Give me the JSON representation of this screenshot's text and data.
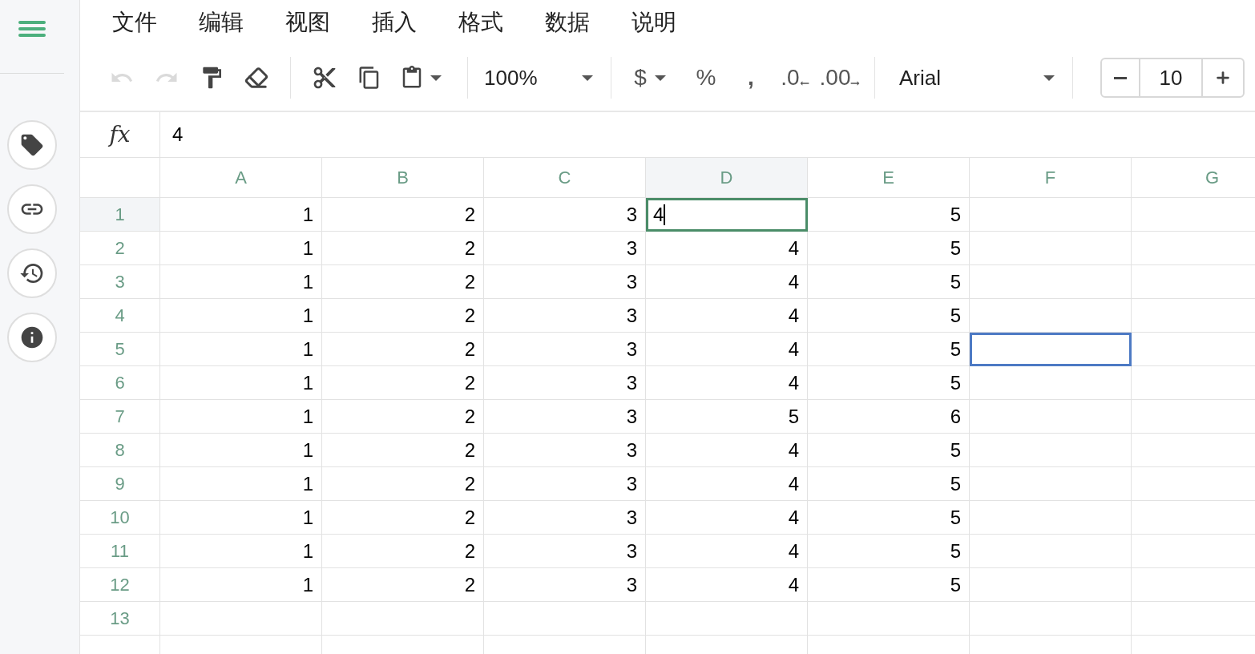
{
  "menu": [
    {
      "label": "文件"
    },
    {
      "label": "编辑"
    },
    {
      "label": "视图"
    },
    {
      "label": "插入"
    },
    {
      "label": "格式"
    },
    {
      "label": "数据"
    },
    {
      "label": "说明"
    }
  ],
  "toolbar": {
    "history": [
      {
        "kind": "undo",
        "disabled": true
      },
      {
        "kind": "redo",
        "disabled": true
      }
    ],
    "zoom": {
      "value": "100%"
    },
    "number_formats": [
      {
        "kind": "currency",
        "label": "$"
      },
      {
        "kind": "percent",
        "label": "%"
      },
      {
        "kind": "comma",
        "label": ","
      },
      {
        "kind": "decrease-decimals",
        "label": ".0"
      },
      {
        "kind": "increase-decimals",
        "label": ".00"
      }
    ],
    "font": {
      "value": "Arial"
    },
    "font_size": {
      "value": "10"
    }
  },
  "formula_bar": {
    "label": "fx",
    "value": "4"
  },
  "sheet": {
    "columns": [
      {
        "label": "A",
        "selected": false
      },
      {
        "label": "B",
        "selected": false
      },
      {
        "label": "C",
        "selected": false
      },
      {
        "label": "D",
        "selected": true
      },
      {
        "label": "E",
        "selected": false
      },
      {
        "label": "F",
        "selected": false
      },
      {
        "label": "G",
        "selected": false
      }
    ],
    "rows": [
      {
        "label": "1",
        "selected": true,
        "cells": [
          {
            "kind": "plain",
            "value": "1"
          },
          {
            "kind": "plain",
            "value": "2"
          },
          {
            "kind": "plain",
            "value": "3"
          },
          {
            "kind": "editing",
            "value": "4"
          },
          {
            "kind": "plain",
            "value": "5"
          },
          {
            "kind": "plain"
          },
          {
            "kind": "plain"
          }
        ]
      },
      {
        "label": "2",
        "selected": false,
        "cells": [
          {
            "kind": "plain",
            "value": "1"
          },
          {
            "kind": "plain",
            "value": "2"
          },
          {
            "kind": "plain",
            "value": "3"
          },
          {
            "kind": "plain",
            "value": "4"
          },
          {
            "kind": "plain",
            "value": "5"
          },
          {
            "kind": "plain"
          },
          {
            "kind": "plain"
          }
        ]
      },
      {
        "label": "3",
        "selected": false,
        "cells": [
          {
            "kind": "plain",
            "value": "1"
          },
          {
            "kind": "plain",
            "value": "2"
          },
          {
            "kind": "plain",
            "value": "3"
          },
          {
            "kind": "plain",
            "value": "4"
          },
          {
            "kind": "plain",
            "value": "5"
          },
          {
            "kind": "plain"
          },
          {
            "kind": "plain"
          }
        ]
      },
      {
        "label": "4",
        "selected": false,
        "cells": [
          {
            "kind": "plain",
            "value": "1"
          },
          {
            "kind": "plain",
            "value": "2"
          },
          {
            "kind": "plain",
            "value": "3"
          },
          {
            "kind": "plain",
            "value": "4"
          },
          {
            "kind": "plain",
            "value": "5"
          },
          {
            "kind": "plain"
          },
          {
            "kind": "plain"
          }
        ]
      },
      {
        "label": "5",
        "selected": false,
        "cells": [
          {
            "kind": "plain",
            "value": "1"
          },
          {
            "kind": "plain",
            "value": "2"
          },
          {
            "kind": "plain",
            "value": "3"
          },
          {
            "kind": "plain",
            "value": "4"
          },
          {
            "kind": "plain",
            "value": "5"
          },
          {
            "kind": "selected"
          },
          {
            "kind": "plain"
          }
        ]
      },
      {
        "label": "6",
        "selected": false,
        "cells": [
          {
            "kind": "plain",
            "value": "1"
          },
          {
            "kind": "plain",
            "value": "2"
          },
          {
            "kind": "plain",
            "value": "3"
          },
          {
            "kind": "plain",
            "value": "4"
          },
          {
            "kind": "plain",
            "value": "5"
          },
          {
            "kind": "plain"
          },
          {
            "kind": "plain"
          }
        ]
      },
      {
        "label": "7",
        "selected": false,
        "cells": [
          {
            "kind": "plain",
            "value": "1"
          },
          {
            "kind": "plain",
            "value": "2"
          },
          {
            "kind": "plain",
            "value": "3"
          },
          {
            "kind": "plain",
            "value": "5"
          },
          {
            "kind": "plain",
            "value": "6"
          },
          {
            "kind": "plain"
          },
          {
            "kind": "plain"
          }
        ]
      },
      {
        "label": "8",
        "selected": false,
        "cells": [
          {
            "kind": "plain",
            "value": "1"
          },
          {
            "kind": "plain",
            "value": "2"
          },
          {
            "kind": "plain",
            "value": "3"
          },
          {
            "kind": "plain",
            "value": "4"
          },
          {
            "kind": "plain",
            "value": "5"
          },
          {
            "kind": "plain"
          },
          {
            "kind": "plain"
          }
        ]
      },
      {
        "label": "9",
        "selected": false,
        "cells": [
          {
            "kind": "plain",
            "value": "1"
          },
          {
            "kind": "plain",
            "value": "2"
          },
          {
            "kind": "plain",
            "value": "3"
          },
          {
            "kind": "plain",
            "value": "4"
          },
          {
            "kind": "plain",
            "value": "5"
          },
          {
            "kind": "plain"
          },
          {
            "kind": "plain"
          }
        ]
      },
      {
        "label": "10",
        "selected": false,
        "cells": [
          {
            "kind": "plain",
            "value": "1"
          },
          {
            "kind": "plain",
            "value": "2"
          },
          {
            "kind": "plain",
            "value": "3"
          },
          {
            "kind": "plain",
            "value": "4"
          },
          {
            "kind": "plain",
            "value": "5"
          },
          {
            "kind": "plain"
          },
          {
            "kind": "plain"
          }
        ]
      },
      {
        "label": "11",
        "selected": false,
        "cells": [
          {
            "kind": "plain",
            "value": "1"
          },
          {
            "kind": "plain",
            "value": "2"
          },
          {
            "kind": "plain",
            "value": "3"
          },
          {
            "kind": "plain",
            "value": "4"
          },
          {
            "kind": "plain",
            "value": "5"
          },
          {
            "kind": "plain"
          },
          {
            "kind": "plain"
          }
        ]
      },
      {
        "label": "12",
        "selected": false,
        "cells": [
          {
            "kind": "plain",
            "value": "1"
          },
          {
            "kind": "plain",
            "value": "2"
          },
          {
            "kind": "plain",
            "value": "3"
          },
          {
            "kind": "plain",
            "value": "4"
          },
          {
            "kind": "plain",
            "value": "5"
          },
          {
            "kind": "plain"
          },
          {
            "kind": "plain"
          }
        ]
      },
      {
        "label": "13",
        "selected": false,
        "cells": [
          {
            "kind": "plain"
          },
          {
            "kind": "plain"
          },
          {
            "kind": "plain"
          },
          {
            "kind": "plain"
          },
          {
            "kind": "plain"
          },
          {
            "kind": "plain"
          },
          {
            "kind": "plain"
          }
        ]
      }
    ]
  }
}
